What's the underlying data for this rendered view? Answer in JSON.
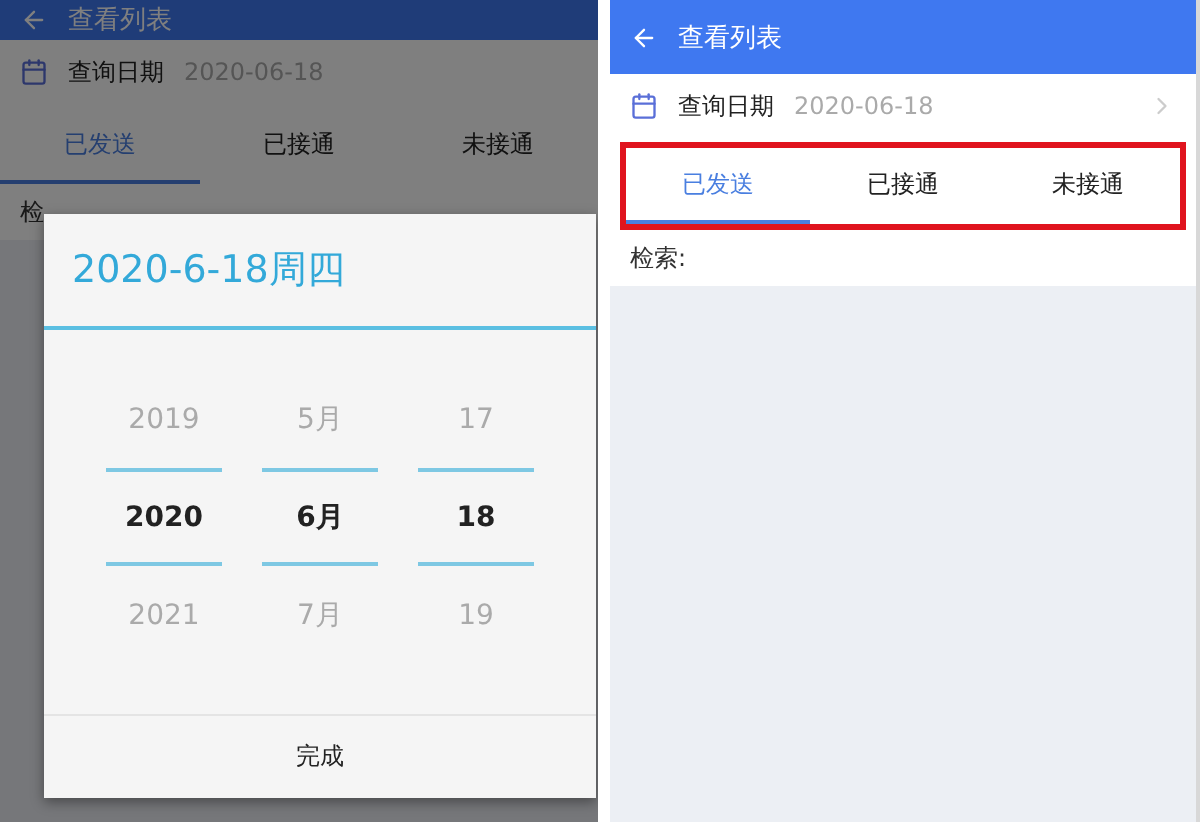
{
  "screens": [
    {
      "dimmed": true,
      "title": "查看列表",
      "date_label": "查询日期",
      "date_value": "2020-06-18",
      "show_chevron": false,
      "highlight_tabs": false,
      "tabs": [
        {
          "label": "已发送",
          "selected": true
        },
        {
          "label": "已接通",
          "selected": false
        },
        {
          "label": "未接通",
          "selected": false
        }
      ],
      "search_label": "检",
      "dialog": {
        "title": "2020-6-18周四",
        "columns": [
          {
            "items": [
              {
                "text": "2019",
                "selected": false
              },
              {
                "text": "2020",
                "selected": true
              },
              {
                "text": "2021",
                "selected": false
              }
            ]
          },
          {
            "items": [
              {
                "text": "5月",
                "selected": false
              },
              {
                "text": "6月",
                "selected": true
              },
              {
                "text": "7月",
                "selected": false
              }
            ]
          },
          {
            "items": [
              {
                "text": "17",
                "selected": false
              },
              {
                "text": "18",
                "selected": true
              },
              {
                "text": "19",
                "selected": false
              }
            ]
          }
        ],
        "button": "完成"
      }
    },
    {
      "dimmed": false,
      "title": "查看列表",
      "date_label": "查询日期",
      "date_value": "2020-06-18",
      "show_chevron": true,
      "highlight_tabs": true,
      "tabs": [
        {
          "label": "已发送",
          "selected": true
        },
        {
          "label": "已接通",
          "selected": false
        },
        {
          "label": "未接通",
          "selected": false
        }
      ],
      "search_label": "检索:"
    }
  ]
}
